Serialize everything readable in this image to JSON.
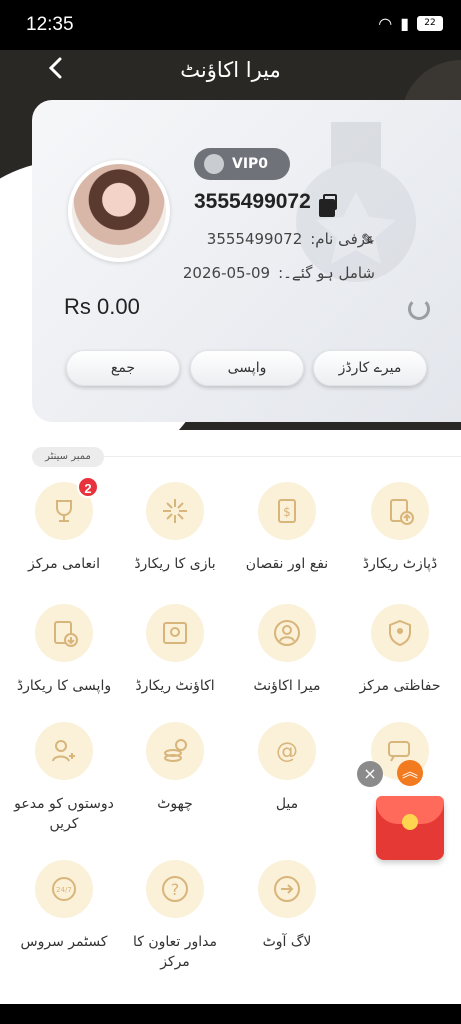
{
  "status": {
    "time": "12:35",
    "battery": "22"
  },
  "header": {
    "title": "میرا اکاؤنٹ"
  },
  "profile": {
    "vip": "VIP0",
    "uid": "3555499072",
    "nickname_label": "عرفی نام:",
    "nickname": "3555499072",
    "joined_label": ":شامل ہو گئے۔",
    "joined_date": "2026-05-09",
    "balance": "Rs 0.00"
  },
  "actions": {
    "cards": "میرے کارڈز",
    "withdraw": "واپسی",
    "deposit": "جمع"
  },
  "section_tag": "ممبر سینٹر",
  "menu": [
    {
      "label": "ڈپازٹ ریکارڈ",
      "icon": "deposit-record-icon"
    },
    {
      "label": "نفع اور نقصان",
      "icon": "profit-loss-icon"
    },
    {
      "label": "بازی کا ریکارڈ",
      "icon": "bet-record-icon"
    },
    {
      "label": "انعامی مرکز",
      "icon": "trophy-icon",
      "badge": "2"
    },
    {
      "label": "حفاظتی مرکز",
      "icon": "shield-icon"
    },
    {
      "label": "میرا اکاؤنٹ",
      "icon": "user-icon"
    },
    {
      "label": "اکاؤنٹ ریکارڈ",
      "icon": "account-record-icon"
    },
    {
      "label": "واپسی کا ریکارڈ",
      "icon": "withdraw-record-icon"
    },
    {
      "label": "میل",
      "icon": "at-icon"
    },
    {
      "label": "چھوٹ",
      "icon": "rebate-icon"
    },
    {
      "label": "دوستوں کو مدعو کریں",
      "icon": "invite-icon"
    },
    {
      "label": "لاگ آوٹ",
      "icon": "logout-icon"
    },
    {
      "label": "مداور تعاون کا مرکز",
      "icon": "help-icon"
    },
    {
      "label": "کسٹمر سروس",
      "icon": "support-icon"
    }
  ]
}
